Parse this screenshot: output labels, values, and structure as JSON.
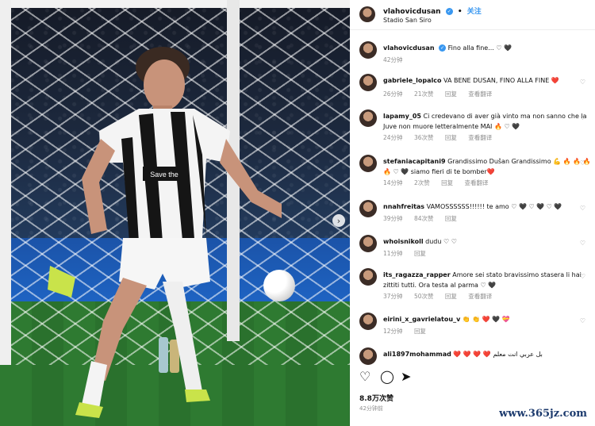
{
  "post": {
    "username": "vlahovicdusan",
    "follow_label": "关注",
    "location": "Stadio San Siro",
    "caption": "Fino alla fine... ♡ 🖤",
    "caption_time": "42分钟",
    "likes": "8.8万次赞",
    "time": "42分钟前"
  },
  "comments": [
    {
      "user": "gabriele_lopalco",
      "text": "VA BENE DUSAN, FINO ALLA FINE ❤️",
      "time": "26分钟",
      "likes": "21次赞",
      "reply": "回复",
      "translate": "查看翻译"
    },
    {
      "user": "lapamy_05",
      "text": "Ci credevano di aver già vinto ma non sanno che la Juve non muore letteralmente MAI 🔥 ♡ 🖤",
      "time": "24分钟",
      "likes": "36次赞",
      "reply": "回复",
      "translate": "查看翻译"
    },
    {
      "user": "stefaniacapitani9",
      "text": "Grandissimo Dušan Grandissimo 💪 🔥 🔥 🔥 🔥 ♡ 🖤 siamo fieri di te bomber❤️",
      "time": "14分钟",
      "likes": "2次赞",
      "reply": "回复",
      "translate": "查看翻译"
    },
    {
      "user": "nnahfreitas",
      "text": "VAMOSSSSSS!!!!!! te amo ♡ 🖤 ♡ 🖤 ♡ 🖤",
      "time": "39分钟",
      "likes": "84次赞",
      "reply": "回复",
      "translate": ""
    },
    {
      "user": "whoisnikoll",
      "text": "dudu ♡ ♡",
      "time": "11分钟",
      "likes": "",
      "reply": "回复",
      "translate": ""
    },
    {
      "user": "its_ragazza_rapper",
      "text": "Amore sei stato bravissimo stasera li hai zittiti tutti. Ora testa al parma ♡ 🖤",
      "time": "37分钟",
      "likes": "50次赞",
      "reply": "回复",
      "translate": "查看翻译"
    },
    {
      "user": "eirini_x_gavrielatou_v",
      "text": "👏 👏 ❤️ 🖤 💝",
      "time": "12分钟",
      "likes": "",
      "reply": "回复",
      "translate": ""
    },
    {
      "user": "ali1897mohammad",
      "text": "❤️ ❤️ ❤️ ❤️ بل عربي انت معلم",
      "time": "",
      "likes": "",
      "reply": "",
      "translate": ""
    }
  ],
  "icons": {
    "like": "heart-icon",
    "comment": "comment-icon",
    "share": "send-icon",
    "next": "chevron-right-icon",
    "verified": "verified-badge-icon"
  },
  "watermark": "www.365jz.com",
  "colors": {
    "accent": "#3897f0",
    "meta": "#8e8e8e"
  }
}
